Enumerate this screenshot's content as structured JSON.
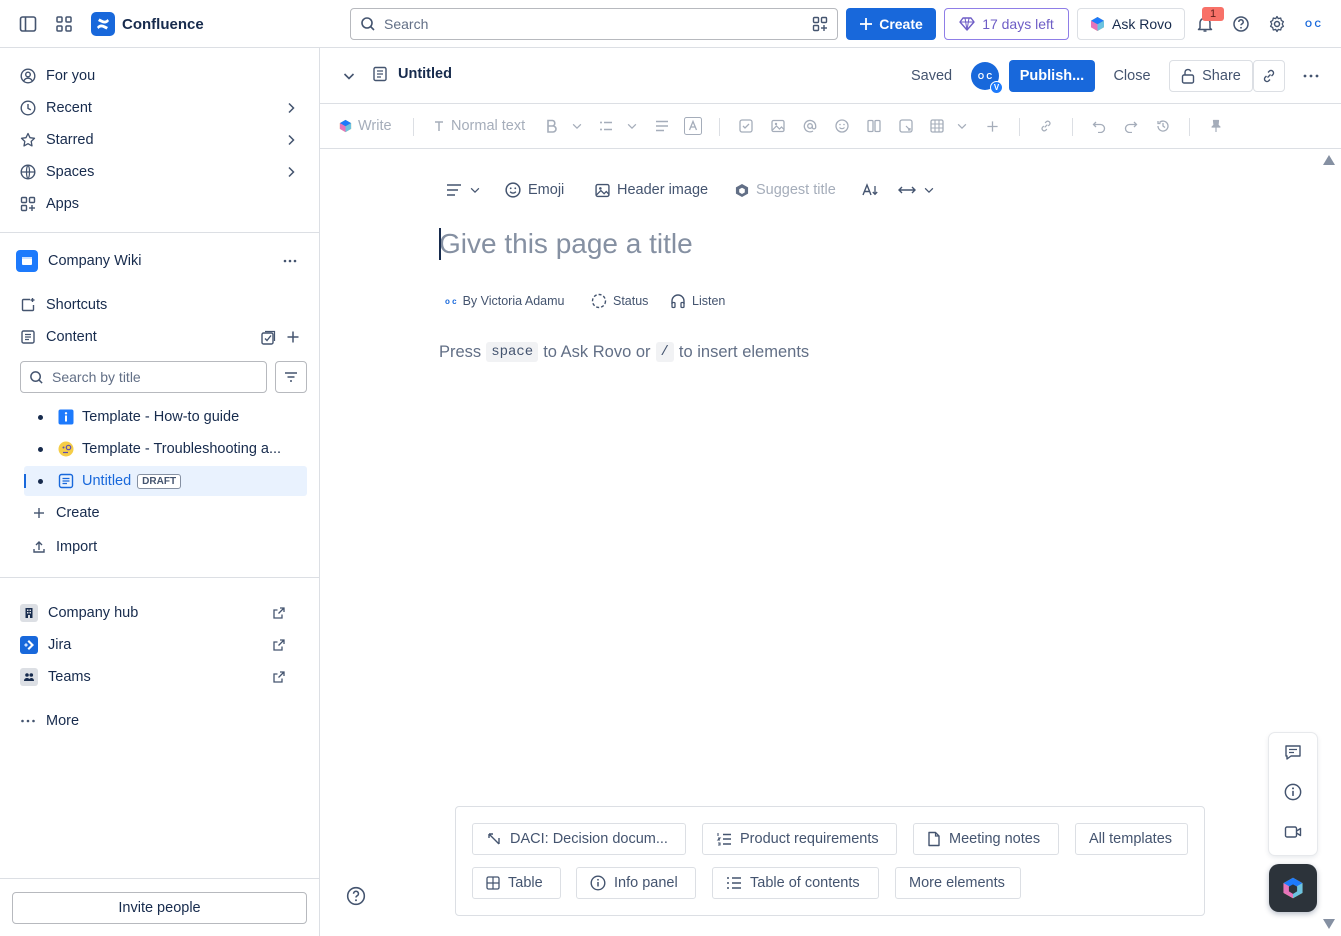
{
  "topbar": {
    "product_name": "Confluence",
    "search_placeholder": "Search",
    "create_label": "Create",
    "trial_label": "17 days left",
    "rovo_label": "Ask Rovo",
    "notification_count": "1",
    "avatar_initials": "O C",
    "brand_color": "#1868db"
  },
  "sidebar": {
    "nav": [
      {
        "label": "For you",
        "icon": "person-circle-icon"
      },
      {
        "label": "Recent",
        "icon": "clock-icon"
      },
      {
        "label": "Starred",
        "icon": "star-icon"
      },
      {
        "label": "Spaces",
        "icon": "globe-icon"
      },
      {
        "label": "Apps",
        "icon": "apps-icon"
      }
    ],
    "space_name": "Company Wiki",
    "shortcuts_label": "Shortcuts",
    "content_label": "Content",
    "title_search_placeholder": "Search by title",
    "tree": [
      {
        "label": "Template - How-to guide",
        "icon": "info-icon"
      },
      {
        "label": "Template - Troubleshooting a...",
        "icon": "face-icon"
      },
      {
        "label": "Untitled",
        "icon": "page-icon",
        "badge": "DRAFT",
        "selected": true
      }
    ],
    "create_label": "Create",
    "import_label": "Import",
    "apps": [
      {
        "label": "Company hub",
        "icon": "building-icon"
      },
      {
        "label": "Jira",
        "icon": "jira-icon"
      },
      {
        "label": "Teams",
        "icon": "teams-icon"
      }
    ],
    "more_label": "More",
    "invite_label": "Invite people"
  },
  "page_header": {
    "title": "Untitled",
    "status": "Saved",
    "avatar_initials": "O C",
    "avatar_badge": "V",
    "publish_label": "Publish...",
    "close_label": "Close",
    "share_label": "Share"
  },
  "toolbar": {
    "write_label": "Write",
    "text_style_label": "Normal text"
  },
  "editor": {
    "emoji_label": "Emoji",
    "header_image_label": "Header image",
    "suggest_title_label": "Suggest title",
    "title_placeholder": "Give this page a title",
    "byline_author": "By Victoria Adamu",
    "status_label": "Status",
    "listen_label": "Listen",
    "hint_press": "Press",
    "hint_key_space": "space",
    "hint_mid": "to Ask Rovo or",
    "hint_key_slash": "/",
    "hint_end": "to insert elements"
  },
  "templates": {
    "row1": [
      {
        "label": "DACI: Decision docum...",
        "icon": "daci-icon"
      },
      {
        "label": "Product requirements",
        "icon": "list-numbered-icon"
      },
      {
        "label": "Meeting notes",
        "icon": "document-icon"
      },
      {
        "label": "All templates",
        "icon": ""
      }
    ],
    "row2": [
      {
        "label": "Table",
        "icon": "table-icon"
      },
      {
        "label": "Info panel",
        "icon": "info-icon"
      },
      {
        "label": "Table of contents",
        "icon": "toc-icon"
      },
      {
        "label": "More elements",
        "icon": ""
      }
    ]
  }
}
